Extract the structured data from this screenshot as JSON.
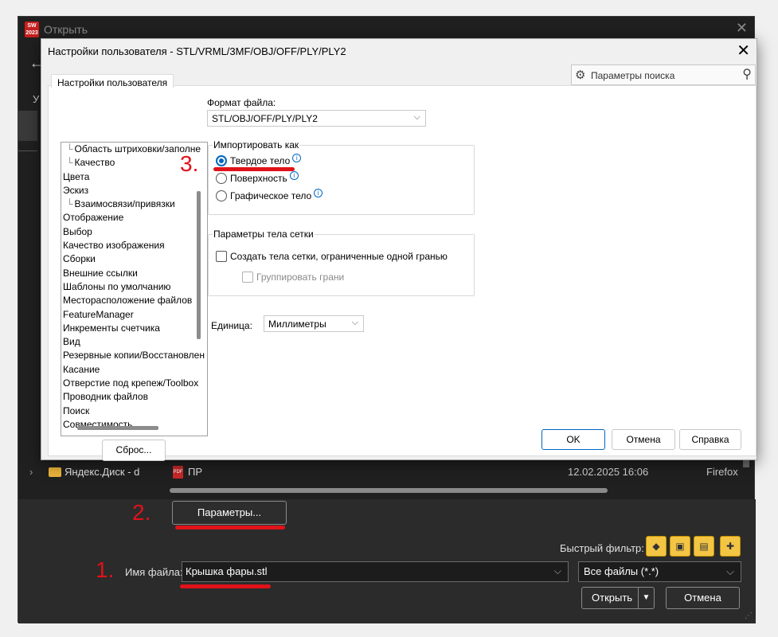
{
  "outer_dialog": {
    "title": "Открыть",
    "logo_text": "SW 2023",
    "side_letter": "У",
    "file_row": {
      "folder_label": "Яндекс.Диск - d",
      "file_name": "ПР",
      "file_date": "12.02.2025 16:06",
      "file_type": "Firefox"
    },
    "params_button": "Параметры...",
    "quick_filter_label": "Быстрый фильтр:",
    "file_name_label": "Имя файла:",
    "file_name_value": "Крышка фары.stl",
    "file_type_value": "Все файлы (*.*)",
    "open_button": "Открыть",
    "cancel_button": "Отмена"
  },
  "inner_dialog": {
    "title": "Настройки пользователя - STL/VRML/3MF/OBJ/OFF/PLY/PLY2",
    "search_placeholder": "Параметры поиска",
    "tab_label": "Настройки пользователя",
    "tree_items": [
      {
        "label": "Область штриховки/заполне",
        "sub": true
      },
      {
        "label": "Качество",
        "sub": true
      },
      {
        "label": "Цвета",
        "sub": false
      },
      {
        "label": "Эскиз",
        "sub": false
      },
      {
        "label": "Взаимосвязи/привязки",
        "sub": true
      },
      {
        "label": "Отображение",
        "sub": false
      },
      {
        "label": "Выбор",
        "sub": false
      },
      {
        "label": "Качество изображения",
        "sub": false
      },
      {
        "label": "Сборки",
        "sub": false
      },
      {
        "label": "Внешние ссылки",
        "sub": false
      },
      {
        "label": "Шаблоны по умолчанию",
        "sub": false
      },
      {
        "label": "Месторасположение файлов",
        "sub": false
      },
      {
        "label": "FeatureManager",
        "sub": false
      },
      {
        "label": "Инкременты счетчика",
        "sub": false
      },
      {
        "label": "Вид",
        "sub": false
      },
      {
        "label": "Резервные копии/Восстановлен",
        "sub": false
      },
      {
        "label": "Касание",
        "sub": false
      },
      {
        "label": "Отверстие под крепеж/Toolbox",
        "sub": false
      },
      {
        "label": "Проводник файлов",
        "sub": false
      },
      {
        "label": "Поиск",
        "sub": false
      },
      {
        "label": "Совместимость",
        "sub": false
      }
    ],
    "reset_button": "Сброс...",
    "file_format_label": "Формат файла:",
    "file_format_value": "STL/OBJ/OFF/PLY/PLY2",
    "import_as_title": "Импортировать как",
    "import_options": [
      {
        "label": "Твердое тело",
        "selected": true
      },
      {
        "label": "Поверхность",
        "selected": false
      },
      {
        "label": "Графическое тело",
        "selected": false
      }
    ],
    "mesh_params_title": "Параметры тела сетки",
    "mesh_checkbox_1": "Создать тела сетки, ограниченные одной гранью",
    "mesh_checkbox_2": "Группировать грани",
    "unit_label": "Единица:",
    "unit_value": "Миллиметры",
    "ok_button": "OK",
    "cancel_button": "Отмена",
    "help_button": "Справка"
  },
  "annotations": {
    "step1": "1.",
    "step2": "2.",
    "step3": "3.",
    "color": "#e0121a"
  }
}
